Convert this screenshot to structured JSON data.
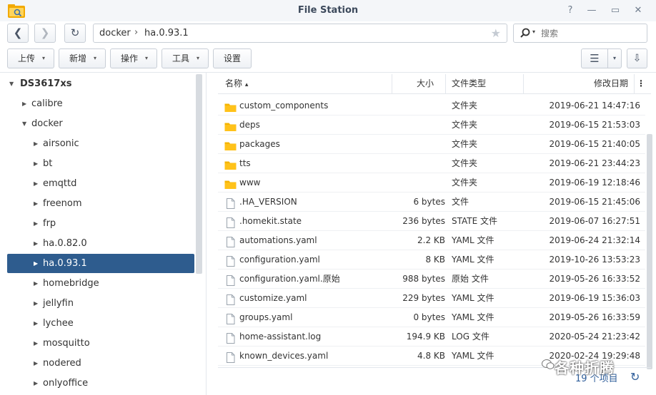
{
  "window": {
    "title": "File Station",
    "help_glyph": "?",
    "min_glyph": "—",
    "max_glyph": "▭",
    "close_glyph": "✕"
  },
  "nav": {
    "back_glyph": "❮",
    "forward_glyph": "❯",
    "refresh_glyph": "↻"
  },
  "path": {
    "segments": [
      "docker",
      "ha.0.93.1"
    ],
    "separator": "›",
    "star_glyph": "★"
  },
  "search": {
    "placeholder": "搜索"
  },
  "toolbar": {
    "upload_label": "上传",
    "create_label": "新增",
    "action_label": "操作",
    "tools_label": "工具",
    "settings_label": "设置",
    "caret": "▾",
    "list_view_glyph": "☰",
    "sort_glyph": "⇩"
  },
  "tree": {
    "root": "DS3617xs",
    "items": [
      {
        "label": "calibre",
        "level": 1,
        "expanded": false
      },
      {
        "label": "docker",
        "level": 1,
        "expanded": true
      },
      {
        "label": "airsonic",
        "level": 2,
        "expanded": false
      },
      {
        "label": "bt",
        "level": 2,
        "expanded": false
      },
      {
        "label": "emqttd",
        "level": 2,
        "expanded": false
      },
      {
        "label": "freenom",
        "level": 2,
        "expanded": false
      },
      {
        "label": "frp",
        "level": 2,
        "expanded": false
      },
      {
        "label": "ha.0.82.0",
        "level": 2,
        "expanded": false
      },
      {
        "label": "ha.0.93.1",
        "level": 2,
        "expanded": false,
        "selected": true
      },
      {
        "label": "homebridge",
        "level": 2,
        "expanded": false
      },
      {
        "label": "jellyfin",
        "level": 2,
        "expanded": false
      },
      {
        "label": "lychee",
        "level": 2,
        "expanded": false
      },
      {
        "label": "mosquitto",
        "level": 2,
        "expanded": false
      },
      {
        "label": "nodered",
        "level": 2,
        "expanded": false
      },
      {
        "label": "onlyoffice",
        "level": 2,
        "expanded": false
      }
    ]
  },
  "columns": {
    "name": "名称",
    "name_sort": "▴",
    "size": "大小",
    "type": "文件类型",
    "modified": "修改日期",
    "menu_glyph": "⋮"
  },
  "files": [
    {
      "name": "custom_components",
      "size": "",
      "type": "文件夹",
      "modified": "2019-06-21 14:47:16",
      "kind": "folder"
    },
    {
      "name": "deps",
      "size": "",
      "type": "文件夹",
      "modified": "2019-06-15 21:53:03",
      "kind": "folder"
    },
    {
      "name": "packages",
      "size": "",
      "type": "文件夹",
      "modified": "2019-06-15 21:40:05",
      "kind": "folder"
    },
    {
      "name": "tts",
      "size": "",
      "type": "文件夹",
      "modified": "2019-06-21 23:44:23",
      "kind": "folder"
    },
    {
      "name": "www",
      "size": "",
      "type": "文件夹",
      "modified": "2019-06-19 12:18:46",
      "kind": "folder"
    },
    {
      "name": ".HA_VERSION",
      "size": "6 bytes",
      "type": "文件",
      "modified": "2019-06-15 21:45:06",
      "kind": "file"
    },
    {
      "name": ".homekit.state",
      "size": "236 bytes",
      "type": "STATE 文件",
      "modified": "2019-06-07 16:27:51",
      "kind": "file"
    },
    {
      "name": "automations.yaml",
      "size": "2.2 KB",
      "type": "YAML 文件",
      "modified": "2019-06-24 21:32:14",
      "kind": "file"
    },
    {
      "name": "configuration.yaml",
      "size": "8 KB",
      "type": "YAML 文件",
      "modified": "2019-10-26 13:53:23",
      "kind": "file"
    },
    {
      "name": "configuration.yaml.原始",
      "size": "988 bytes",
      "type": "原始 文件",
      "modified": "2019-05-26 16:33:52",
      "kind": "file"
    },
    {
      "name": "customize.yaml",
      "size": "229 bytes",
      "type": "YAML 文件",
      "modified": "2019-06-19 15:36:03",
      "kind": "file"
    },
    {
      "name": "groups.yaml",
      "size": "0 bytes",
      "type": "YAML 文件",
      "modified": "2019-05-26 16:33:59",
      "kind": "file"
    },
    {
      "name": "home-assistant.log",
      "size": "194.9 KB",
      "type": "LOG 文件",
      "modified": "2020-05-24 21:23:42",
      "kind": "file"
    },
    {
      "name": "known_devices.yaml",
      "size": "4.8 KB",
      "type": "YAML 文件",
      "modified": "2020-02-24 19:29:48",
      "kind": "file"
    }
  ],
  "status": {
    "count": "19 个项目",
    "refresh_glyph": "↻"
  },
  "watermark": {
    "text": "各种折腾"
  },
  "colors": {
    "selection": "#2e5c8e",
    "folder": "#f5b400",
    "accent": "#2f5e9a"
  }
}
